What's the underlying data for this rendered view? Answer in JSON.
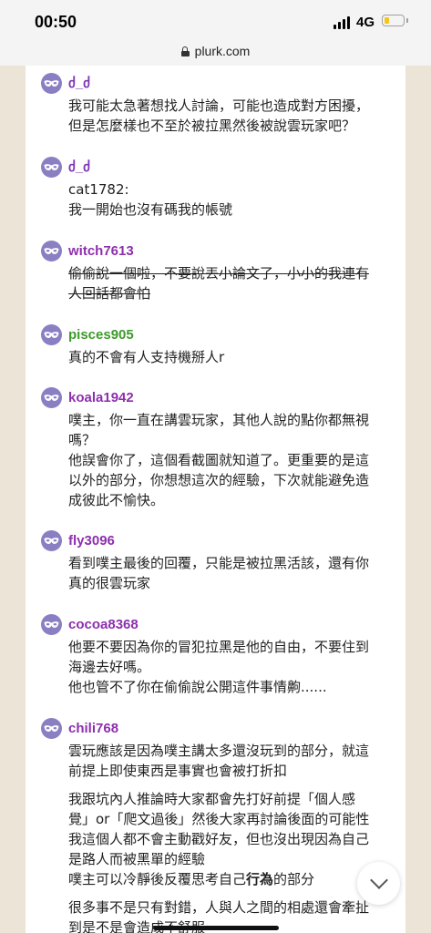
{
  "status_bar": {
    "time": "00:50",
    "network": "4G",
    "battery_level": 0.25
  },
  "browser": {
    "url": "plurk.com"
  },
  "colors": {
    "frame": "#ece4d6",
    "avatar": "#8a7fc2"
  },
  "responses": [
    {
      "username": "ძ_ძ",
      "name_color": "#7d35b5",
      "lines": [
        "我可能太急著想找人討論，可能也造成對方困擾，",
        "但是怎麼樣也不至於被拉黑然後被說雲玩家吧？"
      ]
    },
    {
      "username": "ძ_ძ",
      "name_color": "#7d35b5",
      "lines": [
        "cat1782:",
        "我一開始也沒有碼我的帳號"
      ]
    },
    {
      "username": "witch7613",
      "name_color": "#8d2fae",
      "lines": [
        "偷偷說一個啦，不要說丟小論文了，小小的我連有",
        "人回話都會怕"
      ]
    },
    {
      "username": "pisces905",
      "name_color": "#3d9a2b",
      "lines": [
        "真的不會有人支持機掰人r"
      ]
    },
    {
      "username": "koala1942",
      "name_color": "#8d2fae",
      "lines": [
        "噗主，你一直在講雲玩家，其他人說的點你都無視",
        "嗎？",
        "他誤會你了，這個看截圖就知道了。更重要的是這",
        "以外的部分，你想想這次的經驗，下次就能避免造",
        "成彼此不愉快。"
      ]
    },
    {
      "username": "fly3096",
      "name_color": "#8d2fae",
      "lines": [
        "看到噗主最後的回覆，只能是被拉黑活該，還有你",
        "真的很雲玩家"
      ]
    },
    {
      "username": "cocoa8368",
      "name_color": "#8d2fae",
      "lines": [
        "他要不要因為你的冒犯拉黑是他的自由，不要住到",
        "海邊去好嗎。",
        "他也管不了你在偷偷說公開這件事情齁......"
      ]
    },
    {
      "username": "chili768",
      "name_color": "#8d2fae",
      "lines": [
        "雲玩應該是因為噗主講太多還沒玩到的部分，就這",
        "前提上即使東西是事實也會被打折扣"
      ],
      "para2": [
        "我跟坑內人推論時大家都會先打好前提「個人感",
        "覺」or「爬文過後」然後大家再討論後面的可能性",
        "我這個人都不會主動戳好友，但也沒出現因為自己",
        "是路人而被黑單的經驗"
      ],
      "para2_last": {
        "before": "噗主可以冷靜後反覆思考自己",
        "bold": "行為",
        "after": "的部分"
      },
      "para3": [
        "很多事不是只有對錯，人與人之間的相處還會牽扯",
        "到是不是會造成不舒服"
      ]
    }
  ]
}
